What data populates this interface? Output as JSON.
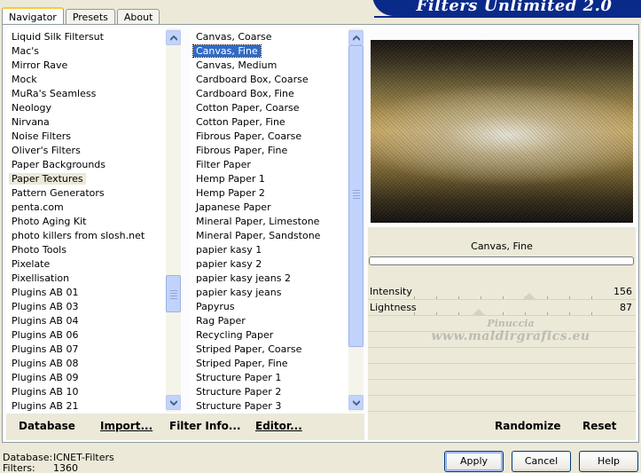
{
  "app_title": "Filters Unlimited 2.0",
  "tabs": [
    {
      "label": "Navigator",
      "active": true
    },
    {
      "label": "Presets",
      "active": false
    },
    {
      "label": "About",
      "active": false
    }
  ],
  "categories": {
    "items": [
      "Liquid Silk Filtersut",
      "Mac's",
      "Mirror Rave",
      "Mock",
      "MuRa's Seamless",
      "Neology",
      "Nirvana",
      "Noise Filters",
      "Oliver's Filters",
      "Paper Backgrounds",
      "Paper Textures",
      "Pattern Generators",
      "penta.com",
      "Photo Aging Kit",
      "photo killers from slosh.net",
      "Photo Tools",
      "Pixelate",
      "Pixellisation",
      "Plugins AB 01",
      "Plugins AB 03",
      "Plugins AB 04",
      "Plugins AB 06",
      "Plugins AB 07",
      "Plugins AB 08",
      "Plugins AB 09",
      "Plugins AB 10",
      "Plugins AB 21"
    ],
    "highlighted": "Paper Textures"
  },
  "filters": {
    "items": [
      "Canvas, Coarse",
      "Canvas, Fine",
      "Canvas, Medium",
      "Cardboard Box, Coarse",
      "Cardboard Box, Fine",
      "Cotton Paper, Coarse",
      "Cotton Paper, Fine",
      "Fibrous Paper, Coarse",
      "Fibrous Paper, Fine",
      "Filter Paper",
      "Hemp Paper 1",
      "Hemp Paper 2",
      "Japanese Paper",
      "Mineral Paper, Limestone",
      "Mineral Paper, Sandstone",
      "papier kasy 1",
      "papier kasy 2",
      "papier kasy jeans 2",
      "papier kasy jeans",
      "Papyrus",
      "Rag Paper",
      "Recycling Paper",
      "Striped Paper, Coarse",
      "Striped Paper, Fine",
      "Structure Paper 1",
      "Structure Paper 2",
      "Structure Paper 3"
    ],
    "selected": "Canvas, Fine"
  },
  "preview": {
    "filter_name": "Canvas, Fine",
    "params": [
      {
        "label": "Intensity",
        "value": "156",
        "level": 0.61
      },
      {
        "label": "Lightness",
        "value": "87",
        "level": 0.34
      }
    ]
  },
  "watermark": {
    "line1": "Pinuccia",
    "line2": "www.maldirgrafics.eu"
  },
  "bottom_buttons": {
    "database": "Database",
    "import": "Import...",
    "filter_info": "Filter Info...",
    "editor": "Editor...",
    "randomize": "Randomize",
    "reset": "Reset"
  },
  "status": {
    "database_label": "Database:",
    "database_value": "ICNET-Filters",
    "filters_label": "Filters:",
    "filters_value": "1360"
  },
  "dialog_buttons": {
    "apply": "Apply",
    "cancel": "Cancel",
    "help": "Help"
  },
  "colors": {
    "selection": "#316ac5",
    "banner": "#0a2a8a",
    "tab_accent": "#ffc83c"
  }
}
